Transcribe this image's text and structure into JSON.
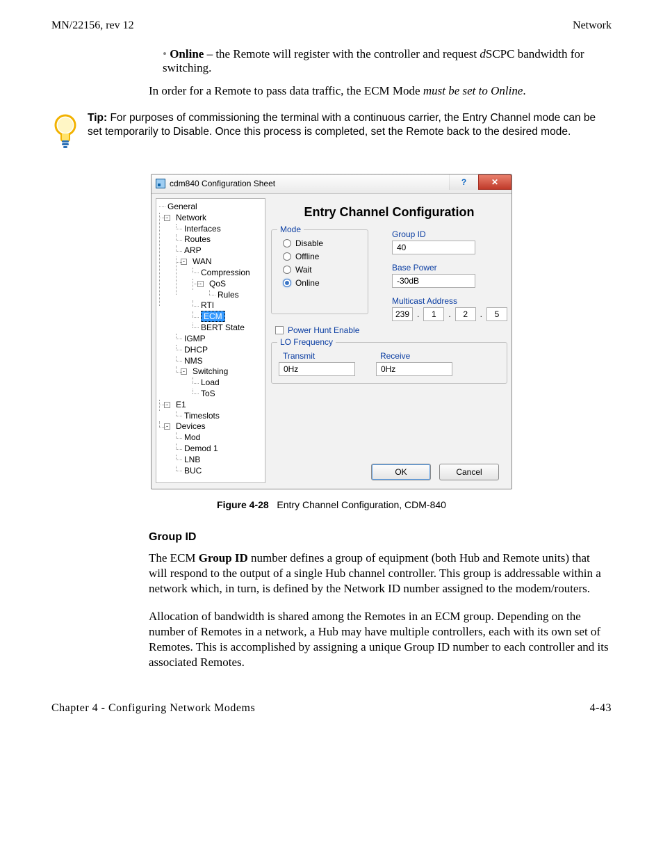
{
  "header": {
    "left": "MN/22156, rev 12",
    "right": "Network"
  },
  "bullet": {
    "term": "Online",
    "text": " – the Remote will register with the controller and request ",
    "italic_prefix": "d",
    "after_italic": "SCPC bandwidth for switching."
  },
  "paragraph1_a": "In order for a Remote to pass data traffic, the ECM Mode ",
  "paragraph1_italic": "must be set to Online",
  "paragraph1_b": ".",
  "tip": {
    "label": "Tip:",
    "text": "For purposes of commissioning the terminal with a continuous carrier, the Entry Channel mode can be set temporarily to Disable. Once this process is completed, set the Remote back to the desired mode."
  },
  "dialog": {
    "title": "cdm840 Configuration Sheet",
    "help_glyph": "?",
    "close_glyph": "✕",
    "panel_title": "Entry Channel Configuration",
    "tree": {
      "general": "General",
      "network": "Network",
      "interfaces": "Interfaces",
      "routes": "Routes",
      "arp": "ARP",
      "wan": "WAN",
      "compression": "Compression",
      "qos": "QoS",
      "rules": "Rules",
      "rti": "RTI",
      "ecm": "ECM",
      "bert": "BERT State",
      "igmp": "IGMP",
      "dhcp": "DHCP",
      "nms": "NMS",
      "switching": "Switching",
      "load": "Load",
      "tos": "ToS",
      "e1": "E1",
      "timeslots": "Timeslots",
      "devices": "Devices",
      "mod": "Mod",
      "demod1": "Demod 1",
      "lnb": "LNB",
      "buc": "BUC"
    },
    "mode": {
      "legend": "Mode",
      "disable": "Disable",
      "offline": "Offline",
      "wait": "Wait",
      "online": "Online"
    },
    "group_id": {
      "label": "Group ID",
      "value": "40"
    },
    "base_power": {
      "label": "Base Power",
      "value": "-30dB"
    },
    "multicast": {
      "label": "Multicast Address",
      "segments": [
        "239",
        "1",
        "2",
        "5"
      ]
    },
    "power_hunt": "Power Hunt Enable",
    "lo_freq": {
      "legend": "LO Frequency",
      "tx_label": "Transmit",
      "tx_val": "0Hz",
      "rx_label": "Receive",
      "rx_val": "0Hz"
    },
    "buttons": {
      "ok": "OK",
      "cancel": "Cancel"
    }
  },
  "figure_caption_bold": "Figure 4-28",
  "figure_caption_rest": "Entry Channel Configuration, CDM-840",
  "section_heading": "Group ID",
  "p2a": "The ECM ",
  "p2b_bold": "Group ID",
  "p2c": " number defines a group of equipment (both Hub and Remote units) that will respond to the output of a single Hub channel controller. This group is addressable within a network which, in turn, is defined by the Network ID number assigned to the modem/routers.",
  "p3": "Allocation of bandwidth is shared among the Remotes in an ECM group. Depending on the number of Remotes in a network, a Hub may have multiple controllers, each with its own set of Remotes. This is accomplished by assigning a unique Group ID number to each controller and its associated Remotes.",
  "footer": {
    "left": "Chapter 4 - Configuring Network Modems",
    "right": "4-43"
  }
}
